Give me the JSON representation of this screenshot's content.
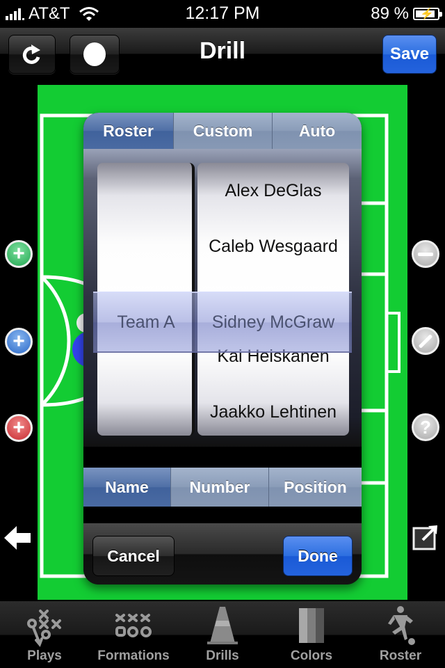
{
  "status_bar": {
    "carrier": "AT&T",
    "time": "12:17 PM",
    "battery_percent": "89 %",
    "battery_level": 0.89
  },
  "nav": {
    "title": "Drill",
    "save_label": "Save",
    "refresh_icon": "refresh-icon",
    "record_icon": "record-icon"
  },
  "side_buttons": {
    "left": [
      "add-green-player",
      "add-blue-player",
      "add-red-player",
      "back-arrow"
    ],
    "right": [
      "remove",
      "draw",
      "help",
      "export"
    ],
    "help_glyph": "?"
  },
  "picker": {
    "source_tabs": [
      {
        "label": "Roster",
        "selected": true
      },
      {
        "label": "Custom",
        "selected": false
      },
      {
        "label": "Auto",
        "selected": false
      }
    ],
    "left_column": {
      "selected": "Team A"
    },
    "right_column": {
      "above": [
        "Alex DeGlas",
        "Caleb Wesgaard"
      ],
      "selected": "Sidney McGraw",
      "below": [
        "Kai Heiskanen",
        "Jaakko Lehtinen"
      ]
    },
    "label_tabs": [
      {
        "label": "Name",
        "selected": true
      },
      {
        "label": "Number",
        "selected": false
      },
      {
        "label": "Position",
        "selected": false
      }
    ],
    "cancel_label": "Cancel",
    "done_label": "Done"
  },
  "colors": {
    "field": "#13cc33",
    "accent_blue": "#2d6fe0",
    "player_blue": "#3344ee"
  },
  "tab_bar": {
    "items": [
      {
        "label": "Plays",
        "icon": "plays-icon"
      },
      {
        "label": "Formations",
        "icon": "formations-icon"
      },
      {
        "label": "Drills",
        "icon": "cone-icon"
      },
      {
        "label": "Colors",
        "icon": "colors-icon"
      },
      {
        "label": "Roster",
        "icon": "player-icon"
      }
    ]
  }
}
